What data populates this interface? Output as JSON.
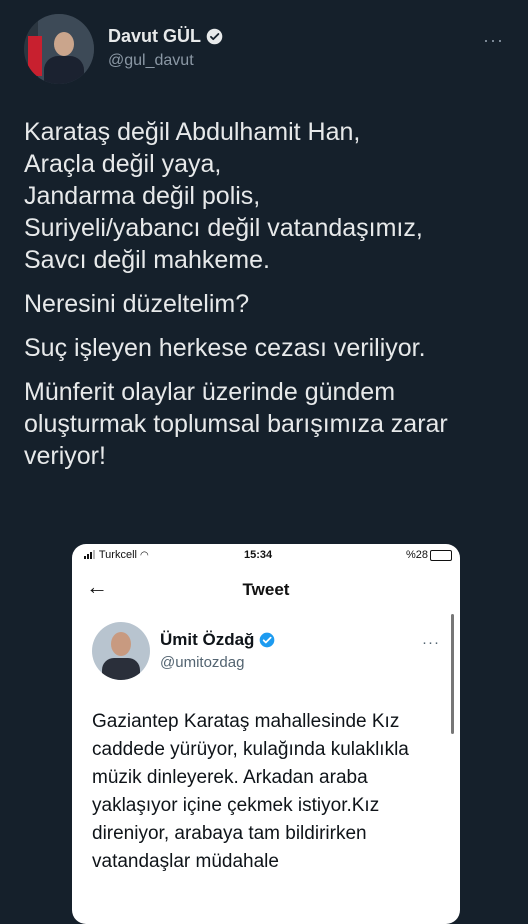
{
  "author": {
    "display_name": "Davut GÜL",
    "handle": "@gul_davut",
    "more_label": "···"
  },
  "tweet": {
    "lines": [
      "Karataş değil Abdulhamit Han,",
      "Araçla değil yaya,",
      "Jandarma değil polis,",
      "Suriyeli/yabancı değil vatandaşımız,",
      "Savcı değil mahkeme."
    ],
    "paragraph_2": "Neresini düzeltelim?",
    "paragraph_3": "Suç işleyen herkese cezası veriliyor.",
    "paragraph_4": "Münferit olaylar üzerinde gündem oluşturmak toplumsal barışımıza zarar veriyor!"
  },
  "screenshot": {
    "status_bar": {
      "carrier": "Turkcell",
      "time": "15:34",
      "battery": "%28"
    },
    "nav": {
      "back_glyph": "←",
      "title": "Tweet"
    },
    "quoted_author": {
      "display_name": "Ümit Özdağ",
      "handle": "@umitozdag",
      "more_label": "···"
    },
    "quoted_text": "Gaziantep Karataş mahallesinde Kız caddede yürüyor, kulağında kulaklıkla müzik dinleyerek. Arkadan araba yaklaşıyor içine çekmek istiyor.Kız direniyor, arabaya tam bildirirken vatandaşlar müdahale"
  },
  "colors": {
    "background": "#15202b",
    "text": "#e7e9ea",
    "secondary_text": "#8b98a5",
    "verified_blue": "#1d9bf0"
  },
  "icons": {
    "verified": "verified-badge-icon",
    "more": "more-options-icon",
    "back": "back-arrow-icon",
    "wifi": "wifi-icon",
    "signal": "signal-icon",
    "battery": "battery-icon"
  }
}
